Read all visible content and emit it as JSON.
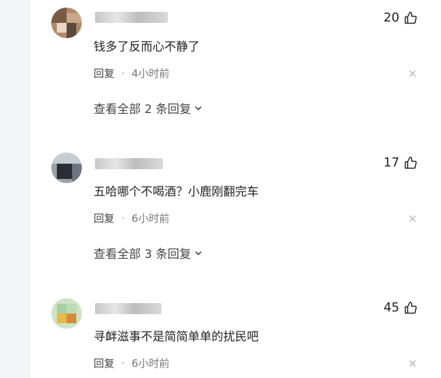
{
  "comments": [
    {
      "likes": "20",
      "text": "钱多了反而心不静了",
      "reply_label": "回复",
      "time": "4小时前",
      "more_replies": "查看全部 2 条回复"
    },
    {
      "likes": "17",
      "text": "五哈哪个不喝酒？小鹿刚翻完车",
      "reply_label": "回复",
      "time": "6小时前",
      "more_replies": "查看全部 3 条回复"
    },
    {
      "likes": "45",
      "text": "寻衅滋事不是简简单单的扰民吧",
      "reply_label": "回复",
      "time": "6小时前"
    }
  ],
  "icons": {
    "like": "thumb-up-icon",
    "close": "close-icon",
    "expand": "chevron-down-icon"
  },
  "colors": {
    "text": "#222222",
    "meta": "#777777",
    "background": "#ffffff",
    "side_panel": "#f4f5f7"
  }
}
